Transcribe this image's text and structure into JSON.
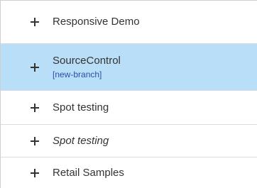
{
  "tree": {
    "items": [
      {
        "label": "Responsive Demo"
      },
      {
        "label": "SourceControl",
        "branch": "[new-branch]",
        "selected": true
      },
      {
        "label": "Spot testing"
      },
      {
        "label": "Spot testing",
        "italic": true
      },
      {
        "label": "Retail Samples"
      }
    ]
  },
  "icons": {
    "expand": "plus-icon"
  },
  "colors": {
    "selected_background": "#b8dff7",
    "branch_text": "#2a4fa8",
    "divider": "#dcdcdc"
  }
}
